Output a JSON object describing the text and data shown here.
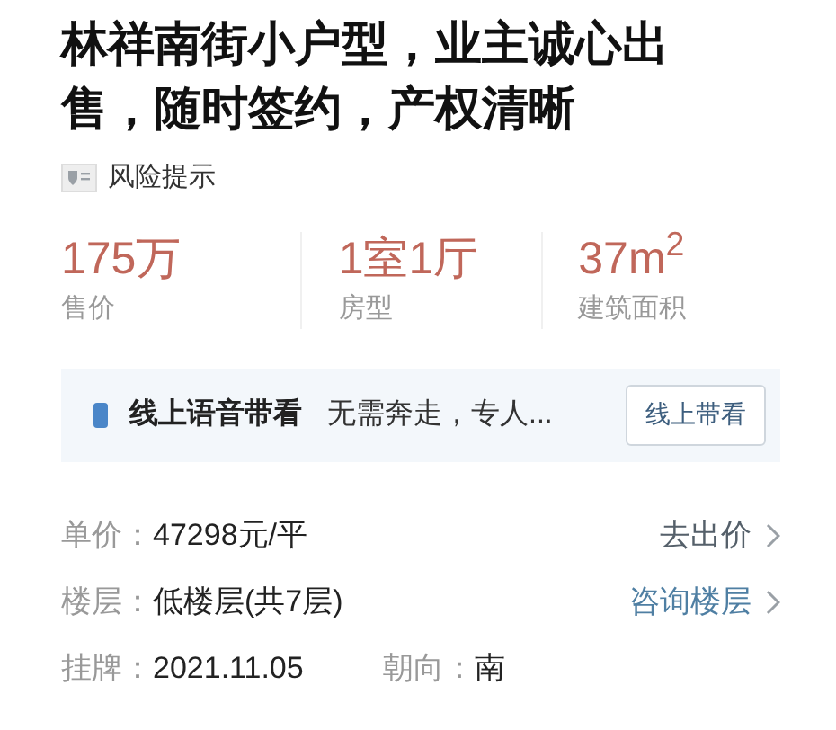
{
  "title": "林祥南街小户型，业主诚心出售，随时签约，产权清晰",
  "risk_notice": "风险提示",
  "stats": [
    {
      "value": "175万",
      "label": "售价"
    },
    {
      "value": "1室1厅",
      "label": "房型"
    },
    {
      "value": "37m$^{2}$",
      "label": "建筑面积"
    }
  ],
  "voice_tour": {
    "title": "线上语音带看",
    "description": "无需奔走，专人...",
    "button": "线上带看"
  },
  "details": [
    {
      "fields": [
        {
          "label": "单价：",
          "value": "47298元/平"
        }
      ],
      "action": {
        "text": "去出价",
        "highlighted": false
      }
    },
    {
      "fields": [
        {
          "label": "楼层：",
          "value": "低楼层(共7层)"
        }
      ],
      "action": {
        "text": "咨询楼层",
        "highlighted": true
      }
    },
    {
      "fields": [
        {
          "label": "挂牌：",
          "value": "2021.11.05"
        },
        {
          "label": "朝向：",
          "value": "南"
        }
      ]
    }
  ]
}
